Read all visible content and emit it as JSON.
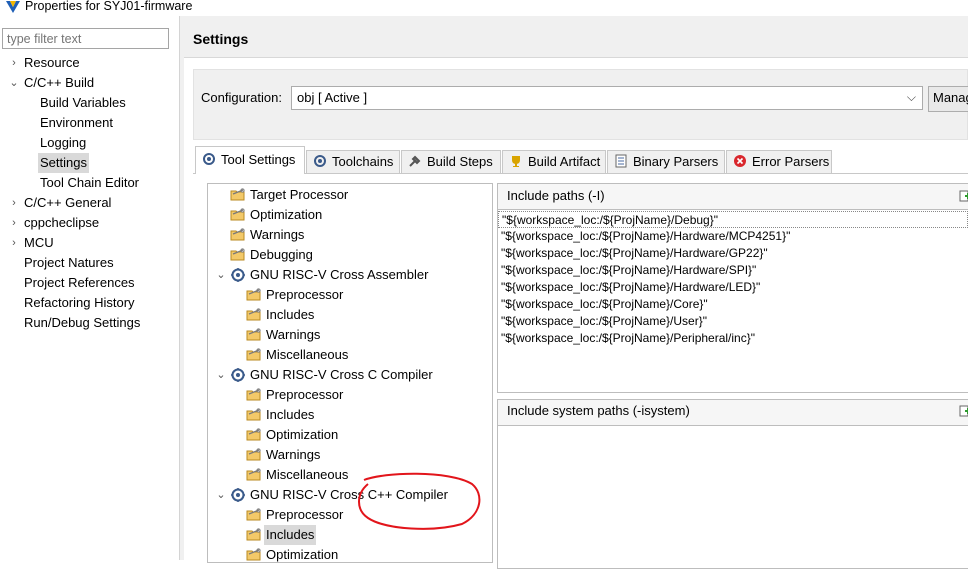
{
  "window": {
    "title": "Properties for SYJ01-firmware"
  },
  "filter": {
    "placeholder": "type filter text"
  },
  "nav": {
    "items": [
      {
        "label": "Resource",
        "arrow": "›",
        "indent": 0
      },
      {
        "label": "C/C++ Build",
        "arrow": "⌄",
        "indent": 0
      },
      {
        "label": "Build Variables",
        "arrow": "",
        "indent": 1
      },
      {
        "label": "Environment",
        "arrow": "",
        "indent": 1
      },
      {
        "label": "Logging",
        "arrow": "",
        "indent": 1
      },
      {
        "label": "Settings",
        "arrow": "",
        "indent": 1,
        "selected": true
      },
      {
        "label": "Tool Chain Editor",
        "arrow": "",
        "indent": 1
      },
      {
        "label": "C/C++ General",
        "arrow": "›",
        "indent": 0
      },
      {
        "label": "cppcheclipse",
        "arrow": "›",
        "indent": 0
      },
      {
        "label": "MCU",
        "arrow": "›",
        "indent": 0
      },
      {
        "label": "Project Natures",
        "arrow": "",
        "indent": 0
      },
      {
        "label": "Project References",
        "arrow": "",
        "indent": 0
      },
      {
        "label": "Refactoring History",
        "arrow": "",
        "indent": 0
      },
      {
        "label": "Run/Debug Settings",
        "arrow": "",
        "indent": 0
      }
    ]
  },
  "header": {
    "title": "Settings"
  },
  "configuration": {
    "label": "Configuration:",
    "value": "obj  [ Active ]",
    "manage_label": "Manage Configurations..."
  },
  "tabs": [
    {
      "label": "Tool Settings",
      "icon": "tool-settings-icon",
      "active": true
    },
    {
      "label": "Toolchains",
      "icon": "toolchains-icon"
    },
    {
      "label": "Build Steps",
      "icon": "build-steps-icon"
    },
    {
      "label": "Build Artifact",
      "icon": "build-artifact-icon"
    },
    {
      "label": "Binary Parsers",
      "icon": "binary-parsers-icon"
    },
    {
      "label": "Error Parsers",
      "icon": "error-parsers-icon"
    }
  ],
  "tool_tree": [
    {
      "label": "Target Processor",
      "level": 1,
      "kind": "folder"
    },
    {
      "label": "Optimization",
      "level": 1,
      "kind": "folder"
    },
    {
      "label": "Warnings",
      "level": 1,
      "kind": "folder"
    },
    {
      "label": "Debugging",
      "level": 1,
      "kind": "folder"
    },
    {
      "label": "GNU RISC-V Cross Assembler",
      "level": 0,
      "kind": "tool"
    },
    {
      "label": "Preprocessor",
      "level": 2,
      "kind": "folder"
    },
    {
      "label": "Includes",
      "level": 2,
      "kind": "folder"
    },
    {
      "label": "Warnings",
      "level": 2,
      "kind": "folder"
    },
    {
      "label": "Miscellaneous",
      "level": 2,
      "kind": "folder"
    },
    {
      "label": "GNU RISC-V Cross C Compiler",
      "level": 0,
      "kind": "tool"
    },
    {
      "label": "Preprocessor",
      "level": 2,
      "kind": "folder"
    },
    {
      "label": "Includes",
      "level": 2,
      "kind": "folder"
    },
    {
      "label": "Optimization",
      "level": 2,
      "kind": "folder"
    },
    {
      "label": "Warnings",
      "level": 2,
      "kind": "folder"
    },
    {
      "label": "Miscellaneous",
      "level": 2,
      "kind": "folder"
    },
    {
      "label": "GNU RISC-V Cross C++ Compiler",
      "level": 0,
      "kind": "tool"
    },
    {
      "label": "Preprocessor",
      "level": 2,
      "kind": "folder"
    },
    {
      "label": "Includes",
      "level": 2,
      "kind": "folder",
      "selected": true
    },
    {
      "label": "Optimization",
      "level": 2,
      "kind": "folder"
    }
  ],
  "include_paths": {
    "title": "Include paths (-I)",
    "items": [
      "\"${workspace_loc:/${ProjName}/Debug}\"",
      "\"${workspace_loc:/${ProjName}/Hardware/MCP4251}\"",
      "\"${workspace_loc:/${ProjName}/Hardware/GP22}\"",
      "\"${workspace_loc:/${ProjName}/Hardware/SPI}\"",
      "\"${workspace_loc:/${ProjName}/Hardware/LED}\"",
      "\"${workspace_loc:/${ProjName}/Core}\"",
      "\"${workspace_loc:/${ProjName}/User}\"",
      "\"${workspace_loc:/${ProjName}/Peripheral/inc}\""
    ]
  },
  "system_paths": {
    "title": "Include system paths (-isystem)",
    "items": []
  },
  "colors": {
    "selection": "#d9d9d9",
    "annotation": "#e2151b",
    "panel_bg": "#f0f0f0"
  }
}
